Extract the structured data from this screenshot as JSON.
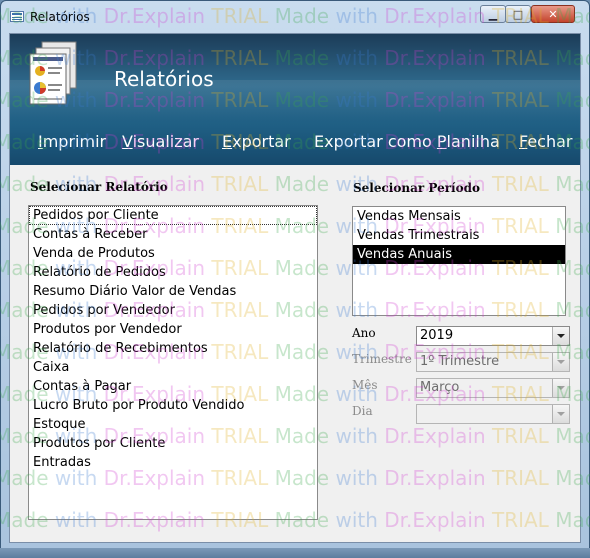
{
  "window": {
    "title": "Relatórios"
  },
  "header": {
    "title": "Relatórios",
    "icon": "report-document-icon"
  },
  "menu": [
    {
      "label": "Imprimir",
      "mnemonic": "I",
      "rest": "mprimir"
    },
    {
      "label": "Visualizar",
      "mnemonic": "V",
      "rest": "isualizar"
    },
    {
      "label": "Exportar",
      "mnemonic": "E",
      "rest": "xportar"
    },
    {
      "label": "Exportar como Planilha",
      "pre": "Exportar como ",
      "mnemonic": "P",
      "rest": "lanilha"
    },
    {
      "label": "Fechar",
      "mnemonic": "F",
      "rest": "echar"
    }
  ],
  "reports": {
    "label": "Selecionar Relatório",
    "items": [
      "Pedidos por Cliente",
      "Contas à Receber",
      "Venda de Produtos",
      "Relatório de Pedidos",
      "Resumo Diário Valor de Vendas",
      "Pedidos por Vendedor",
      "Produtos por Vendedor",
      "Relatório de Recebimentos",
      "Caixa",
      "Contas à Pagar",
      "Lucro Bruto por Produto Vendido",
      "Estoque",
      "Produtos por Cliente",
      "Entradas"
    ]
  },
  "period": {
    "label": "Selecionar Período",
    "items": [
      "Vendas Mensais",
      "Vendas Trimestrais",
      "Vendas Anuais"
    ],
    "selected_index": 2
  },
  "filters": {
    "ano": {
      "label": "Ano",
      "value": "2019"
    },
    "trimestre": {
      "label": "Trimestre",
      "value": "1º Trimestre"
    },
    "mes": {
      "label": "Mês",
      "value": "Março"
    },
    "dia": {
      "label": "Dia",
      "value": ""
    }
  },
  "watermark": {
    "parts": [
      "Made",
      "with",
      "Dr.Explain",
      "TRIAL"
    ]
  },
  "colors": {
    "header_top": "#1c3c58",
    "header_mid": "#2f6b8e",
    "selection": "#000000"
  }
}
